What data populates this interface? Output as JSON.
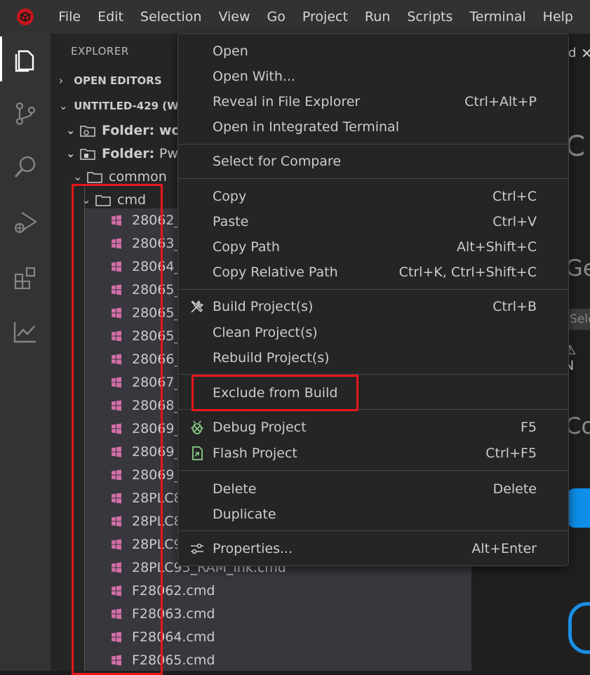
{
  "menubar": {
    "items": [
      "File",
      "Edit",
      "Selection",
      "View",
      "Go",
      "Project",
      "Run",
      "Scripts",
      "Terminal",
      "Help"
    ]
  },
  "activitybar": {
    "icons": [
      "files-icon",
      "source-control-icon",
      "search-icon",
      "run-debug-icon",
      "extensions-icon",
      "chart-icon"
    ]
  },
  "sidebar": {
    "title": "EXPLORER",
    "open_editors": "OPEN EDITORS",
    "workspace": "UNTITLED-429 (WO",
    "folder1_prefix": "Folder:",
    "folder1_name": "wor",
    "folder2_prefix": "Folder:",
    "folder2_name": "Pwr",
    "common": "common",
    "cmd": "cmd",
    "files": [
      "28062_F",
      "28063_F",
      "28064_F",
      "28065_F",
      "28065_F",
      "28065_F",
      "28066_F",
      "28067_F",
      "28068_F",
      "28069_F",
      "28069_F",
      "28069_F",
      "28PLC83",
      "28PLC85",
      "28PLC93",
      "28PLC95_RAM_lnk.cmd",
      "F28062.cmd",
      "F28063.cmd",
      "F28064.cmd",
      "F28065.cmd"
    ]
  },
  "editor": {
    "tab_fragment": "d",
    "close": "✕",
    "big_letter": "C",
    "ge": "Ge",
    "select": "Sele",
    "warn": "⚠ N",
    "co": "Co"
  },
  "context_menu": {
    "open": {
      "label": "Open"
    },
    "open_with": {
      "label": "Open With..."
    },
    "reveal": {
      "label": "Reveal in File Explorer",
      "key": "Ctrl+Alt+P"
    },
    "open_terminal": {
      "label": "Open in Integrated Terminal"
    },
    "select_compare": {
      "label": "Select for Compare"
    },
    "copy": {
      "label": "Copy",
      "key": "Ctrl+C"
    },
    "paste": {
      "label": "Paste",
      "key": "Ctrl+V"
    },
    "copy_path": {
      "label": "Copy Path",
      "key": "Alt+Shift+C"
    },
    "copy_relative": {
      "label": "Copy Relative Path",
      "key": "Ctrl+K, Ctrl+Shift+C"
    },
    "build": {
      "label": "Build Project(s)",
      "key": "Ctrl+B",
      "icon": "tools-icon"
    },
    "clean": {
      "label": "Clean Project(s)"
    },
    "rebuild": {
      "label": "Rebuild Project(s)"
    },
    "exclude": {
      "label": "Exclude from Build"
    },
    "debug": {
      "label": "Debug Project",
      "key": "F5",
      "icon": "bug-icon"
    },
    "flash": {
      "label": "Flash Project",
      "key": "Ctrl+F5",
      "icon": "flash-icon"
    },
    "delete": {
      "label": "Delete",
      "key": "Delete"
    },
    "duplicate": {
      "label": "Duplicate"
    },
    "properties": {
      "label": "Properties...",
      "key": "Alt+Enter",
      "icon": "settings-sliders-icon"
    }
  },
  "colors": {
    "annotation_red": "#e8161b",
    "file_icon_pink": "#d36ea7",
    "debug_green": "#89d185"
  }
}
